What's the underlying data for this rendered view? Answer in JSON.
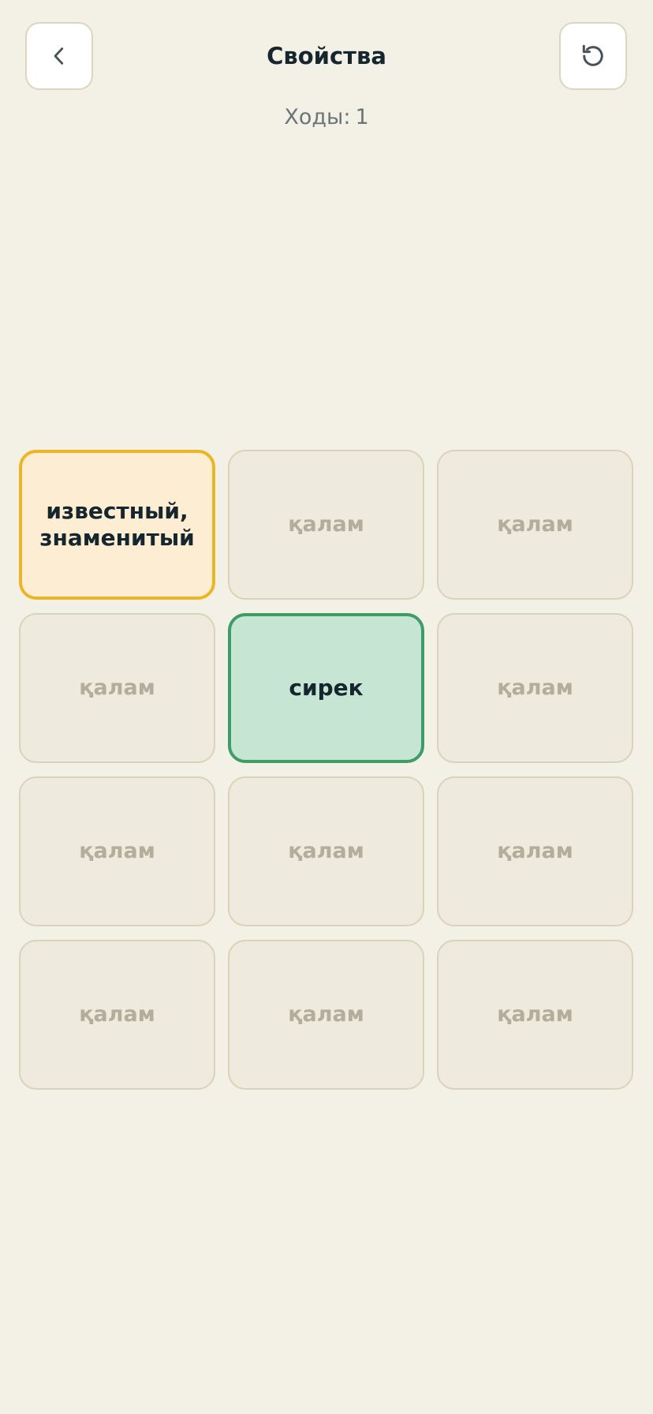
{
  "header": {
    "title": "Свойства",
    "back_icon": "chevron-left-icon",
    "reset_icon": "refresh-icon",
    "moves_label": "Ходы:",
    "moves_value": "1"
  },
  "colors": {
    "background": "#f3f0e6",
    "card_idle": "#eeeadd",
    "card_selected_fill": "#fdeed3",
    "card_selected_border": "#ebb625",
    "card_matched_fill": "#c7e5d3",
    "card_matched_border": "#3c9d66",
    "text_dark": "#16262e"
  },
  "board": {
    "cards": [
      {
        "text": "известный,\nзнаменитый",
        "state": "selected"
      },
      {
        "text": "қалам",
        "state": "hidden"
      },
      {
        "text": "қалам",
        "state": "hidden"
      },
      {
        "text": "қалам",
        "state": "hidden"
      },
      {
        "text": "сирек",
        "state": "matched"
      },
      {
        "text": "қалам",
        "state": "hidden"
      },
      {
        "text": "қалам",
        "state": "hidden"
      },
      {
        "text": "қалам",
        "state": "hidden"
      },
      {
        "text": "қалам",
        "state": "hidden"
      },
      {
        "text": "қалам",
        "state": "hidden"
      },
      {
        "text": "қалам",
        "state": "hidden"
      },
      {
        "text": "қалам",
        "state": "hidden"
      }
    ]
  }
}
